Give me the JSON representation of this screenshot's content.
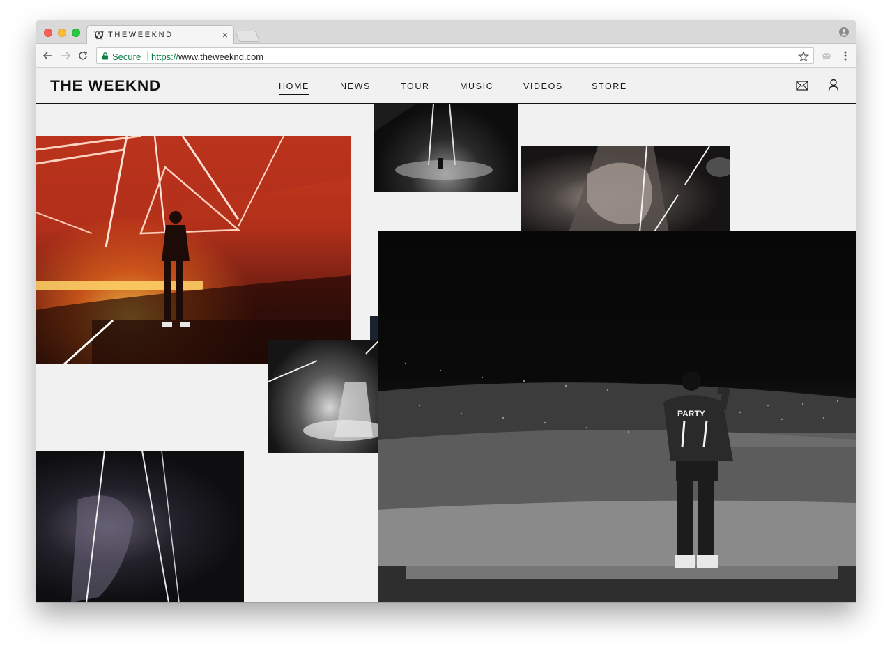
{
  "browser": {
    "tab": {
      "title": "THEWEEKND",
      "close": "×"
    },
    "omnibox": {
      "secure_label": "Secure",
      "url_scheme": "https://",
      "url_host": "www.theweeknd.com"
    }
  },
  "site": {
    "logo": "THE WEEKND",
    "nav": [
      {
        "label": "HOME",
        "active": true
      },
      {
        "label": "NEWS",
        "active": false
      },
      {
        "label": "TOUR",
        "active": false
      },
      {
        "label": "MUSIC",
        "active": false
      },
      {
        "label": "VIDEOS",
        "active": false
      },
      {
        "label": "STORE",
        "active": false
      }
    ],
    "icons": {
      "mail": "mail-icon",
      "account": "user-icon"
    }
  },
  "gallery": {
    "photos": [
      {
        "name": "concert-photo-red-stage"
      },
      {
        "name": "concert-photo-spotlight"
      },
      {
        "name": "concert-photo-rock-prism"
      },
      {
        "name": "concert-photo-smoke-prism"
      },
      {
        "name": "concert-photo-dark-prism"
      },
      {
        "name": "concert-photo-crowd-bw"
      }
    ],
    "jacket_text": "PARTY"
  },
  "colors": {
    "page_background": "#f1f1f1",
    "secure_green": "#0b8043",
    "header_text": "#111111"
  }
}
